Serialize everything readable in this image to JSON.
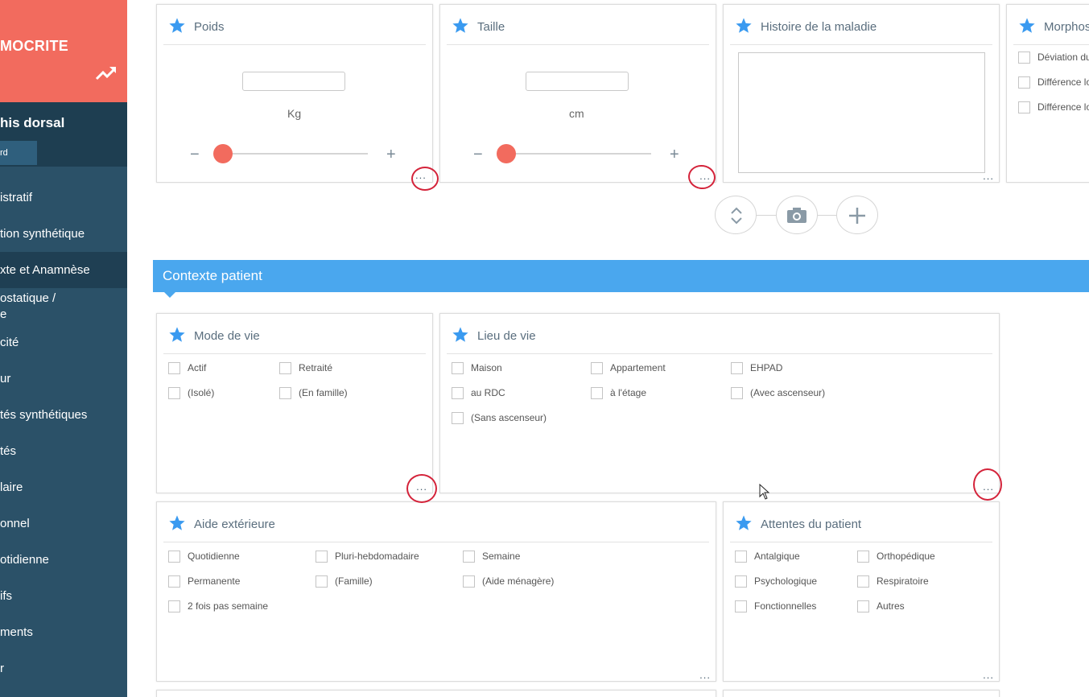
{
  "sidebar": {
    "brand_name": "MOCRITE",
    "brand_icon": "trend-up-icon",
    "patient_name": "his dorsal",
    "patient_tab": "rd",
    "items": [
      {
        "label": "istratif"
      },
      {
        "label": "tion synthétique"
      },
      {
        "label": "xte et Anamnèse"
      },
      {
        "label": "ostatique /",
        "label2": "e"
      },
      {
        "label": "cité"
      },
      {
        "label": "ur"
      },
      {
        "label": "tés synthétiques"
      },
      {
        "label": "tés"
      },
      {
        "label": "laire"
      },
      {
        "label": "onnel"
      },
      {
        "label": "otidienne"
      },
      {
        "label": "ifs"
      },
      {
        "label": "ments"
      },
      {
        "label": "r"
      }
    ]
  },
  "cards": {
    "poids": {
      "title": "Poids",
      "value": "",
      "unit": "Kg",
      "minus": "−",
      "plus": "+",
      "slider": 0.0,
      "more": "..."
    },
    "taille": {
      "title": "Taille",
      "value": "",
      "unit": "cm",
      "minus": "−",
      "plus": "+",
      "slider": 0.0,
      "more": "..."
    },
    "histoire": {
      "title": "Histoire de la maladie",
      "value": "",
      "more": "..."
    },
    "morpho": {
      "title": "Morphos",
      "options": [
        "Déviation du",
        "Différence lo",
        "Différence lo"
      ]
    }
  },
  "actions": {
    "toggle_icon": "expand-collapse-icon",
    "camera_icon": "camera-icon",
    "add_icon": "plus-icon",
    "add_label": "+"
  },
  "section": {
    "title": "Contexte patient"
  },
  "mode_de_vie": {
    "title": "Mode de vie",
    "options": [
      "Actif",
      "Retraité",
      "(Isolé)",
      "(En famille)"
    ],
    "more": "..."
  },
  "lieu_de_vie": {
    "title": "Lieu de vie",
    "options": [
      "Maison",
      "Appartement",
      "EHPAD",
      "au RDC",
      "à l'étage",
      "(Avec ascenseur)",
      "(Sans ascenseur)"
    ],
    "more": "..."
  },
  "aide": {
    "title": "Aide extérieure",
    "options": [
      "Quotidienne",
      "Pluri-hebdomadaire",
      "Semaine",
      "Permanente",
      "(Famille)",
      "(Aide ménagère)",
      "2 fois pas semaine"
    ],
    "more": "..."
  },
  "attentes": {
    "title": "Attentes du patient",
    "options": [
      "Antalgique",
      "Orthopédique",
      "Psychologique",
      "Respiratoire",
      "Fonctionnelles",
      "Autres"
    ],
    "more": "..."
  },
  "colors": {
    "accent": "#4aa7ee",
    "brand": "#f26b5e",
    "sidebar": "#2b5168",
    "annotation": "#d4233a"
  }
}
